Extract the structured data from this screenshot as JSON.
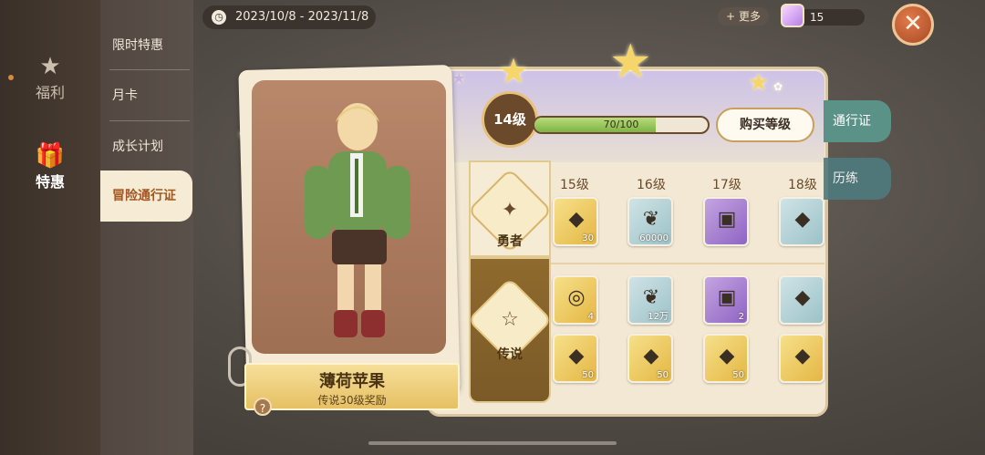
{
  "sidebar": {
    "items": [
      {
        "label": "福利",
        "icon": "star-icon"
      },
      {
        "label": "特惠",
        "icon": "gift-icon"
      }
    ]
  },
  "submenu": {
    "items": [
      {
        "label": "限时特惠"
      },
      {
        "label": "月卡"
      },
      {
        "label": "成长计划"
      },
      {
        "label": "冒险通行证"
      }
    ]
  },
  "header": {
    "date_range": "2023/10/8 - 2023/11/8",
    "more_label": "更多",
    "currency_amount": "15"
  },
  "character": {
    "name": "薄荷苹果",
    "subtitle": "传说30级奖励"
  },
  "pass": {
    "level_label": "14级",
    "xp_text": "70/100",
    "xp_progress": 0.7,
    "buy_level_label": "购买等级",
    "tracks": [
      {
        "label": "勇者"
      },
      {
        "label": "传说"
      }
    ],
    "columns": [
      "15级",
      "16级",
      "17级",
      "18级"
    ],
    "rewards_hero": [
      {
        "type": "gold",
        "icon": "crystal-icon",
        "count": "30"
      },
      {
        "type": "blue",
        "icon": "leaf-icon",
        "count": "60000"
      },
      {
        "type": "purple",
        "icon": "ticket-icon",
        "count": ""
      },
      {
        "type": "blue",
        "icon": "crystal-icon",
        "count": ""
      }
    ],
    "rewards_legend_row1": [
      {
        "type": "gold",
        "icon": "shell-icon",
        "count": "4"
      },
      {
        "type": "blue",
        "icon": "leaf-icon",
        "count": "12万"
      },
      {
        "type": "purple",
        "icon": "ticket-icon",
        "count": "2"
      },
      {
        "type": "blue",
        "icon": "crystal-icon",
        "count": ""
      }
    ],
    "rewards_legend_row2": [
      {
        "type": "gold",
        "icon": "crystal-icon",
        "count": "50"
      },
      {
        "type": "gold",
        "icon": "crystal-icon",
        "count": "50"
      },
      {
        "type": "gold",
        "icon": "crystal-icon",
        "count": "50"
      },
      {
        "type": "gold",
        "icon": "crystal-icon",
        "count": ""
      }
    ]
  },
  "side_tabs": {
    "pass_label": "通行证",
    "train_label": "历练"
  },
  "colors": {
    "accent": "#a3561f",
    "tab_green": "#5a9287",
    "xp_green": "#7db445"
  }
}
